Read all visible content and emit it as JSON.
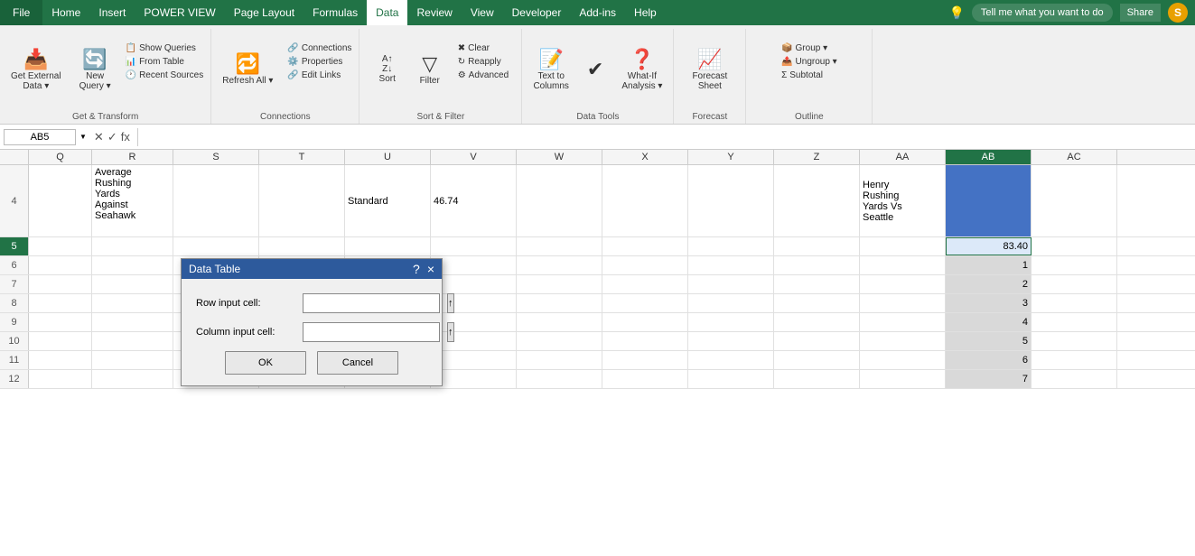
{
  "menubar": {
    "file": "File",
    "items": [
      "Home",
      "Insert",
      "POWER VIEW",
      "Page Layout",
      "Formulas",
      "Data",
      "Review",
      "View",
      "Developer",
      "Add-ins",
      "Help"
    ],
    "active": "Data",
    "tell_me": "Tell me what you want to do",
    "share": "Share"
  },
  "ribbon": {
    "groups": [
      {
        "label": "Get & Transform",
        "buttons": [
          {
            "icon": "📥",
            "label": "Get External\nData",
            "dropdown": true
          },
          {
            "icon": "🔄",
            "label": "New\nQuery",
            "dropdown": true
          },
          {
            "icon": "📋",
            "label": "Show Queries"
          },
          {
            "icon": "📊",
            "label": "From Table"
          },
          {
            "icon": "🕐",
            "label": "Recent Sources"
          }
        ]
      },
      {
        "label": "Connections",
        "buttons": [
          {
            "icon": "🔁",
            "label": "Refresh All",
            "dropdown": true
          },
          {
            "icon": "🔗",
            "label": "Connections"
          },
          {
            "icon": "⚙️",
            "label": "Properties"
          },
          {
            "icon": "🔗",
            "label": "Edit Links"
          }
        ]
      },
      {
        "label": "Sort & Filter",
        "buttons": [
          {
            "icon": "↕",
            "label": "Sort"
          },
          {
            "icon": "▽",
            "label": "Filter"
          },
          {
            "icon": "✖",
            "label": "Clear"
          },
          {
            "icon": "↻",
            "label": "Reapply"
          },
          {
            "icon": "⚙",
            "label": "Advanced"
          }
        ]
      },
      {
        "label": "Data Tools",
        "buttons": [
          {
            "icon": "📝",
            "label": "Text to\nColumns"
          },
          {
            "icon": "🗂",
            "label": ""
          },
          {
            "icon": "❓",
            "label": "What-If\nAnalysis",
            "dropdown": true
          }
        ]
      },
      {
        "label": "Forecast",
        "buttons": [
          {
            "icon": "📈",
            "label": "Forecast\nSheet"
          }
        ]
      },
      {
        "label": "Outline",
        "buttons": [
          {
            "icon": "📦",
            "label": "Group",
            "dropdown": true
          },
          {
            "icon": "📤",
            "label": "Ungroup",
            "dropdown": true
          },
          {
            "icon": "📊",
            "label": "Subtotal"
          }
        ]
      }
    ]
  },
  "formula_bar": {
    "cell_ref": "AB5",
    "formula": "fx"
  },
  "columns": {
    "headers": [
      "",
      "Q",
      "R",
      "S",
      "T",
      "U",
      "V",
      "W",
      "X",
      "Y",
      "Z",
      "AA",
      "AB",
      "AC"
    ],
    "widths": [
      32,
      70,
      90,
      95,
      95,
      95,
      95,
      95,
      95,
      95,
      95,
      95,
      95,
      95
    ]
  },
  "rows": [
    {
      "num": "4",
      "active": false,
      "cells": [
        {
          "col": "Q",
          "val": ""
        },
        {
          "col": "R",
          "val": "Average\nRushing\nYards\nAgainst\nSeahawk"
        },
        {
          "col": "S",
          "val": ""
        },
        {
          "col": "T",
          "val": ""
        },
        {
          "col": "U",
          "val": "Standard"
        },
        {
          "col": "V",
          "val": "46.74"
        },
        {
          "col": "W",
          "val": ""
        },
        {
          "col": "X",
          "val": ""
        },
        {
          "col": "Y",
          "val": ""
        },
        {
          "col": "Z",
          "val": ""
        },
        {
          "col": "AA",
          "val": "Henry\nRushing\nYards Vs\nSeattle"
        },
        {
          "col": "AB",
          "val": "",
          "style": "blue-bg"
        },
        {
          "col": "AC",
          "val": ""
        }
      ]
    },
    {
      "num": "5",
      "active": true,
      "cells": [
        {
          "col": "Q",
          "val": ""
        },
        {
          "col": "R",
          "val": ""
        },
        {
          "col": "S",
          "val": ""
        },
        {
          "col": "T",
          "val": ""
        },
        {
          "col": "U",
          "val": ""
        },
        {
          "col": "V",
          "val": ""
        },
        {
          "col": "W",
          "val": ""
        },
        {
          "col": "X",
          "val": ""
        },
        {
          "col": "Y",
          "val": ""
        },
        {
          "col": "Z",
          "val": ""
        },
        {
          "col": "AA",
          "val": ""
        },
        {
          "col": "AB",
          "val": "83.40",
          "style": "selected"
        },
        {
          "col": "AC",
          "val": ""
        }
      ]
    },
    {
      "num": "6",
      "cells": [
        {
          "col": "Q",
          "val": ""
        },
        {
          "col": "R",
          "val": ""
        },
        {
          "col": "S",
          "val": ""
        },
        {
          "col": "T",
          "val": ""
        },
        {
          "col": "U",
          "val": ""
        },
        {
          "col": "V",
          "val": ""
        },
        {
          "col": "W",
          "val": ""
        },
        {
          "col": "X",
          "val": ""
        },
        {
          "col": "Y",
          "val": ""
        },
        {
          "col": "Z",
          "val": ""
        },
        {
          "col": "AA",
          "val": ""
        },
        {
          "col": "AB",
          "val": "1",
          "style": "gray-bg"
        },
        {
          "col": "AC",
          "val": ""
        }
      ]
    },
    {
      "num": "7",
      "cells": [
        {
          "col": "Q",
          "val": ""
        },
        {
          "col": "R",
          "val": ""
        },
        {
          "col": "S",
          "val": ""
        },
        {
          "col": "T",
          "val": ""
        },
        {
          "col": "U",
          "val": ""
        },
        {
          "col": "V",
          "val": ""
        },
        {
          "col": "W",
          "val": ""
        },
        {
          "col": "X",
          "val": ""
        },
        {
          "col": "Y",
          "val": ""
        },
        {
          "col": "Z",
          "val": ""
        },
        {
          "col": "AA",
          "val": ""
        },
        {
          "col": "AB",
          "val": "2",
          "style": "gray-bg"
        },
        {
          "col": "AC",
          "val": ""
        }
      ]
    },
    {
      "num": "8",
      "cells": [
        {
          "col": "Q",
          "val": ""
        },
        {
          "col": "R",
          "val": ""
        },
        {
          "col": "S",
          "val": ""
        },
        {
          "col": "T",
          "val": ""
        },
        {
          "col": "U",
          "val": ""
        },
        {
          "col": "V",
          "val": ""
        },
        {
          "col": "W",
          "val": ""
        },
        {
          "col": "X",
          "val": ""
        },
        {
          "col": "Y",
          "val": ""
        },
        {
          "col": "Z",
          "val": ""
        },
        {
          "col": "AA",
          "val": ""
        },
        {
          "col": "AB",
          "val": "3",
          "style": "gray-bg"
        },
        {
          "col": "AC",
          "val": ""
        }
      ]
    },
    {
      "num": "9",
      "cells": [
        {
          "col": "Q",
          "val": ""
        },
        {
          "col": "R",
          "val": ""
        },
        {
          "col": "S",
          "val": ""
        },
        {
          "col": "T",
          "val": ""
        },
        {
          "col": "U",
          "val": ""
        },
        {
          "col": "V",
          "val": ""
        },
        {
          "col": "W",
          "val": ""
        },
        {
          "col": "X",
          "val": ""
        },
        {
          "col": "Y",
          "val": ""
        },
        {
          "col": "Z",
          "val": ""
        },
        {
          "col": "AA",
          "val": ""
        },
        {
          "col": "AB",
          "val": "4",
          "style": "gray-bg"
        },
        {
          "col": "AC",
          "val": ""
        }
      ]
    },
    {
      "num": "10",
      "cells": [
        {
          "col": "Q",
          "val": ""
        },
        {
          "col": "R",
          "val": ""
        },
        {
          "col": "S",
          "val": ""
        },
        {
          "col": "T",
          "val": ""
        },
        {
          "col": "U",
          "val": ""
        },
        {
          "col": "V",
          "val": ""
        },
        {
          "col": "W",
          "val": ""
        },
        {
          "col": "X",
          "val": ""
        },
        {
          "col": "Y",
          "val": ""
        },
        {
          "col": "Z",
          "val": ""
        },
        {
          "col": "AA",
          "val": ""
        },
        {
          "col": "AB",
          "val": "5",
          "style": "gray-bg"
        },
        {
          "col": "AC",
          "val": ""
        }
      ]
    },
    {
      "num": "11",
      "cells": [
        {
          "col": "Q",
          "val": ""
        },
        {
          "col": "R",
          "val": ""
        },
        {
          "col": "S",
          "val": ""
        },
        {
          "col": "T",
          "val": ""
        },
        {
          "col": "U",
          "val": ""
        },
        {
          "col": "V",
          "val": ""
        },
        {
          "col": "W",
          "val": ""
        },
        {
          "col": "X",
          "val": ""
        },
        {
          "col": "Y",
          "val": ""
        },
        {
          "col": "Z",
          "val": ""
        },
        {
          "col": "AA",
          "val": ""
        },
        {
          "col": "AB",
          "val": "6",
          "style": "gray-bg"
        },
        {
          "col": "AC",
          "val": ""
        }
      ]
    },
    {
      "num": "12",
      "cells": [
        {
          "col": "Q",
          "val": ""
        },
        {
          "col": "R",
          "val": ""
        },
        {
          "col": "S",
          "val": ""
        },
        {
          "col": "T",
          "val": ""
        },
        {
          "col": "U",
          "val": ""
        },
        {
          "col": "V",
          "val": ""
        },
        {
          "col": "W",
          "val": ""
        },
        {
          "col": "X",
          "val": ""
        },
        {
          "col": "Y",
          "val": ""
        },
        {
          "col": "Z",
          "val": ""
        },
        {
          "col": "AA",
          "val": ""
        },
        {
          "col": "AB",
          "val": "7",
          "style": "gray-bg"
        },
        {
          "col": "AC",
          "val": ""
        }
      ]
    }
  ],
  "dialog": {
    "title": "Data Table",
    "question_icon": "?",
    "close_icon": "×",
    "row_input_label": "Row input cell:",
    "col_input_label": "Column input cell:",
    "ok_label": "OK",
    "cancel_label": "Cancel"
  }
}
